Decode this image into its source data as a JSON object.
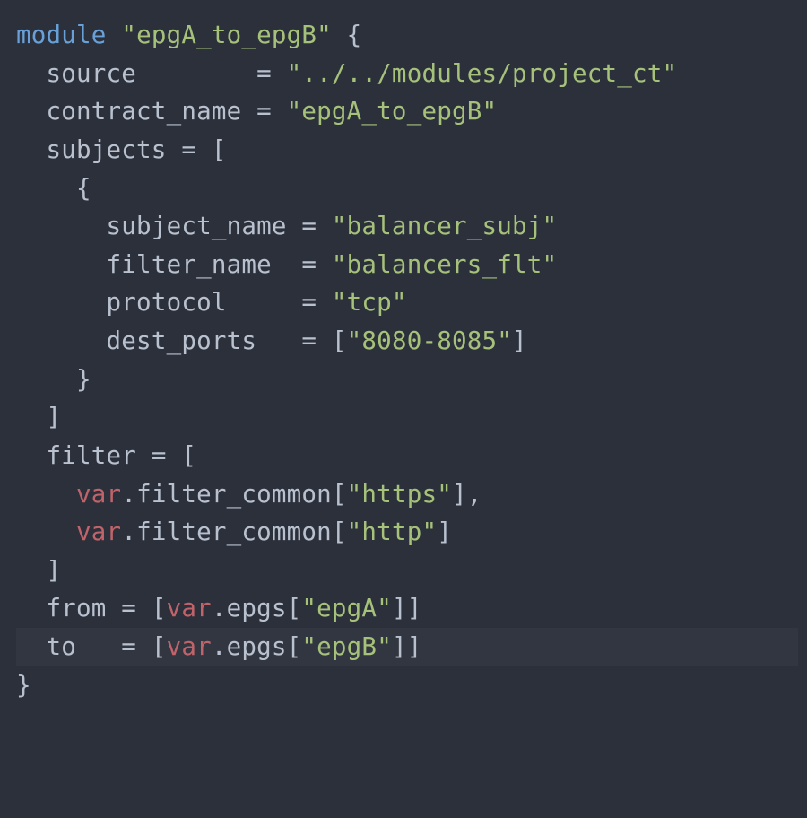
{
  "code": {
    "kw_module": "module",
    "module_name": "\"epgA_to_epgB\"",
    "open_brace": "{",
    "k_source": "source",
    "v_source": "\"../../modules/project_ct\"",
    "k_contract": "contract_name",
    "v_contract": "\"epgA_to_epgB\"",
    "k_subjects": "subjects",
    "k_subject_name": "subject_name",
    "v_subject_name": "\"balancer_subj\"",
    "k_filter_name": "filter_name",
    "v_filter_name": "\"balancers_flt\"",
    "k_protocol": "protocol",
    "v_protocol": "\"tcp\"",
    "k_dest_ports": "dest_ports",
    "v_dest_ports": "\"8080-8085\"",
    "k_filter": "filter",
    "var_kw": "var",
    "filter_common": ".filter_common[",
    "fc_https": "\"https\"",
    "fc_http": "\"http\"",
    "close_br": "]",
    "k_from": "from",
    "k_to": "to",
    "epgs_open": ".epgs[",
    "epgA": "\"epgA\"",
    "epgB": "\"epgB\"",
    "dbl_close": "]]",
    "close_brace": "}"
  }
}
